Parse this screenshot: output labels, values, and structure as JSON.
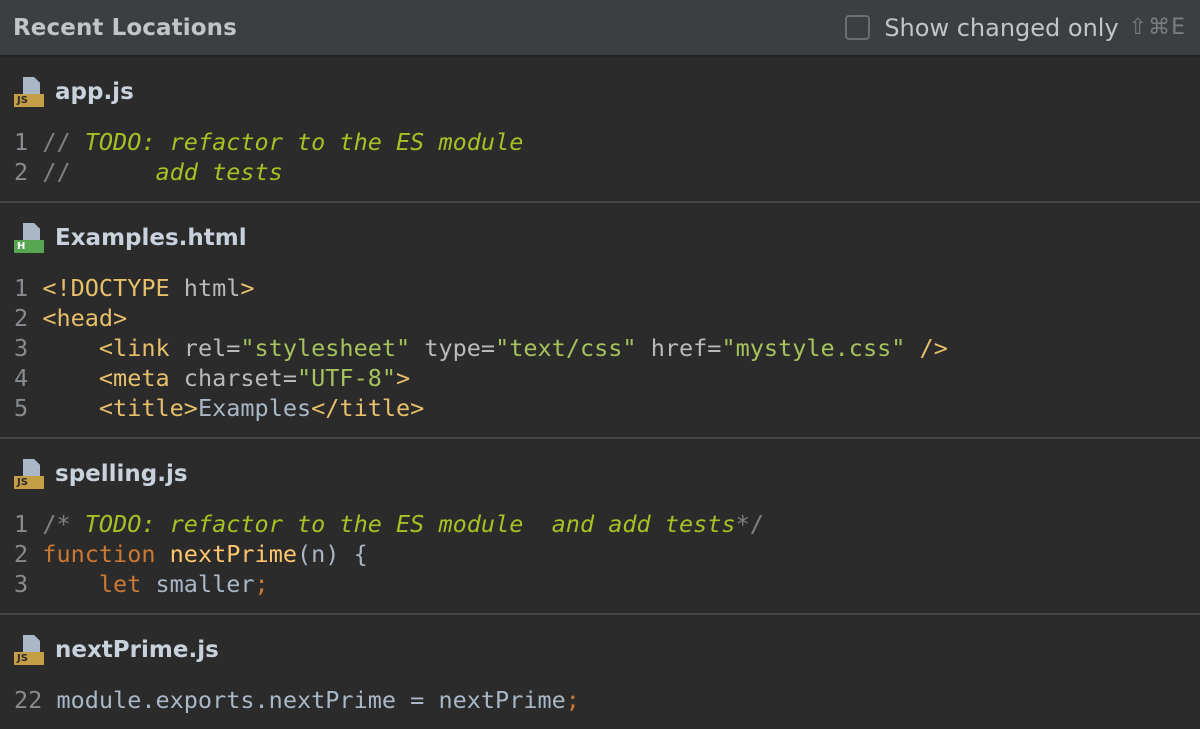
{
  "header": {
    "title": "Recent Locations",
    "checkbox_label": "Show changed only",
    "shortcut": "⇧⌘E",
    "checked": false
  },
  "files": [
    {
      "name": "app.js",
      "badge": "JS",
      "icon": "javascript-file-icon",
      "lines": [
        {
          "num": "1",
          "segments": [
            {
              "cls": "cmt",
              "text": "// "
            },
            {
              "cls": "todo",
              "text": "TODO: refactor to the ES module"
            }
          ]
        },
        {
          "num": "2",
          "segments": [
            {
              "cls": "cmt",
              "text": "//      "
            },
            {
              "cls": "todo",
              "text": "add tests"
            }
          ]
        }
      ]
    },
    {
      "name": "Examples.html",
      "badge": "H",
      "icon": "html-file-icon",
      "lines": [
        {
          "num": "1",
          "segments": [
            {
              "cls": "tag",
              "text": "<!DOCTYPE "
            },
            {
              "cls": "attr",
              "text": "html"
            },
            {
              "cls": "tag",
              "text": ">"
            }
          ]
        },
        {
          "num": "2",
          "segments": [
            {
              "cls": "tag",
              "text": "<head>"
            }
          ]
        },
        {
          "num": "3",
          "segments": [
            {
              "cls": "plain",
              "text": "    "
            },
            {
              "cls": "tag",
              "text": "<link "
            },
            {
              "cls": "attr",
              "text": "rel="
            },
            {
              "cls": "str",
              "text": "\"stylesheet\" "
            },
            {
              "cls": "attr",
              "text": "type="
            },
            {
              "cls": "str",
              "text": "\"text/css\" "
            },
            {
              "cls": "attr",
              "text": "href="
            },
            {
              "cls": "str",
              "text": "\"mystyle.css\" "
            },
            {
              "cls": "tag",
              "text": "/>"
            }
          ]
        },
        {
          "num": "4",
          "segments": [
            {
              "cls": "plain",
              "text": "    "
            },
            {
              "cls": "tag",
              "text": "<meta "
            },
            {
              "cls": "attr",
              "text": "charset="
            },
            {
              "cls": "str",
              "text": "\"UTF-8\""
            },
            {
              "cls": "tag",
              "text": ">"
            }
          ]
        },
        {
          "num": "5",
          "segments": [
            {
              "cls": "plain",
              "text": "    "
            },
            {
              "cls": "tag",
              "text": "<title>"
            },
            {
              "cls": "plain",
              "text": "Examples"
            },
            {
              "cls": "tag",
              "text": "</title>"
            }
          ]
        }
      ]
    },
    {
      "name": "spelling.js",
      "badge": "JS",
      "icon": "javascript-file-icon",
      "lines": [
        {
          "num": "1",
          "segments": [
            {
              "cls": "cmt",
              "text": "/* "
            },
            {
              "cls": "todo",
              "text": "TODO: refactor to the ES module  and add tests"
            },
            {
              "cls": "cmt",
              "text": "*/"
            }
          ]
        },
        {
          "num": "2",
          "segments": [
            {
              "cls": "kw",
              "text": "function "
            },
            {
              "cls": "fn",
              "text": "nextPrime"
            },
            {
              "cls": "plain",
              "text": "(n) {"
            }
          ]
        },
        {
          "num": "3",
          "segments": [
            {
              "cls": "plain",
              "text": "    "
            },
            {
              "cls": "kw",
              "text": "let "
            },
            {
              "cls": "plain",
              "text": "smaller"
            },
            {
              "cls": "kw",
              "text": ";"
            }
          ]
        }
      ]
    },
    {
      "name": "nextPrime.js",
      "badge": "JS",
      "icon": "javascript-file-icon",
      "lines": [
        {
          "num": "22",
          "segments": [
            {
              "cls": "plain",
              "text": "module.exports.nextPrime = nextPrime"
            },
            {
              "cls": "kw",
              "text": ";"
            }
          ]
        }
      ]
    }
  ]
}
